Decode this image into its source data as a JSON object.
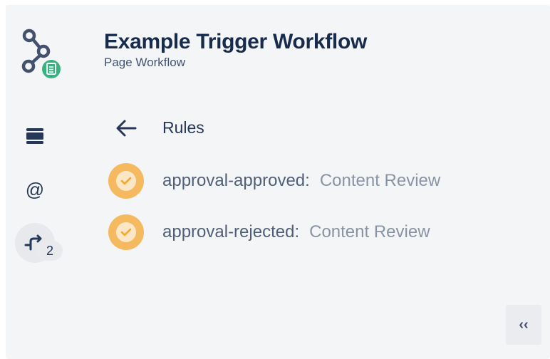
{
  "header": {
    "title": "Example Trigger Workflow",
    "subtitle": "Page Workflow",
    "app_icon": "workflow-nodes-icon",
    "app_icon_badge": "document-icon"
  },
  "sidebar": {
    "items": [
      {
        "icon": "panel-icon",
        "active": false
      },
      {
        "icon": "at-sign-icon",
        "label": "@",
        "active": false
      },
      {
        "icon": "trigger-branch-icon",
        "active": true,
        "badge": "2"
      }
    ]
  },
  "rules_panel": {
    "back_icon": "arrow-left-icon",
    "heading": "Rules",
    "rules": [
      {
        "name": "approval-approved:",
        "target": "Content Review",
        "status_icon": "check-circle-icon"
      },
      {
        "name": "approval-rejected:",
        "target": "Content Review",
        "status_icon": "check-circle-icon"
      }
    ]
  },
  "footer": {
    "collapse_label": "‹‹",
    "collapse_icon": "double-chevron-left-icon"
  },
  "colors": {
    "background": "#f4f5f7",
    "title": "#172b4d",
    "rule_status": "#f5b960",
    "badge_green": "#36b37e"
  }
}
